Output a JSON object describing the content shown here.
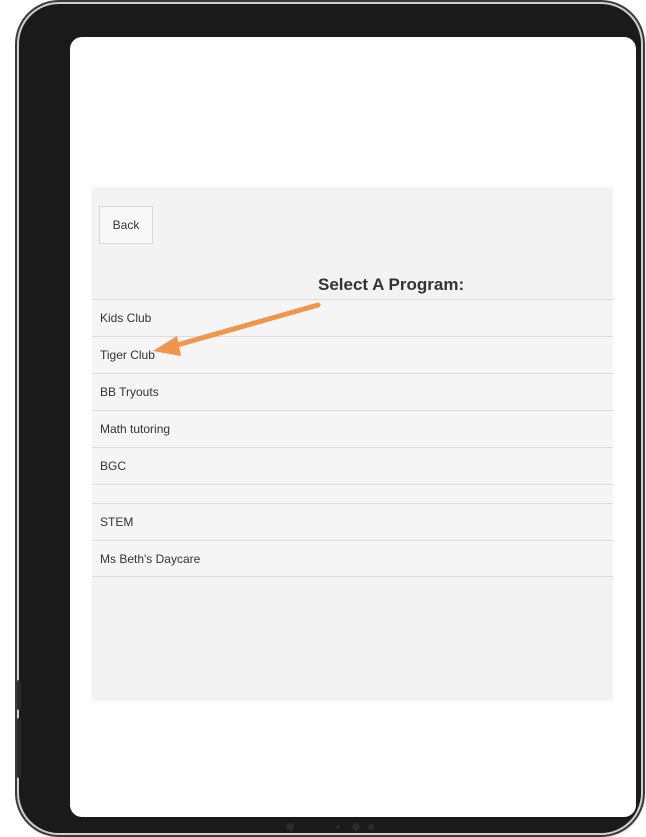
{
  "nav": {
    "back_label": "Back"
  },
  "page": {
    "title": "Select A Program:"
  },
  "programs": [
    {
      "label": "Kids Club"
    },
    {
      "label": "Tiger Club"
    },
    {
      "label": "BB Tryouts"
    },
    {
      "label": "Math tutoring"
    },
    {
      "label": "BGC"
    },
    {
      "label": ""
    },
    {
      "label": "STEM"
    },
    {
      "label": "Ms Beth's Daycare"
    }
  ],
  "annotation": {
    "arrow_color": "#f0954a",
    "points_to": "Tiger Club"
  },
  "colors": {
    "device_frame": "#1a1a1a",
    "panel_background": "#f3f3f3",
    "text": "#333333"
  }
}
